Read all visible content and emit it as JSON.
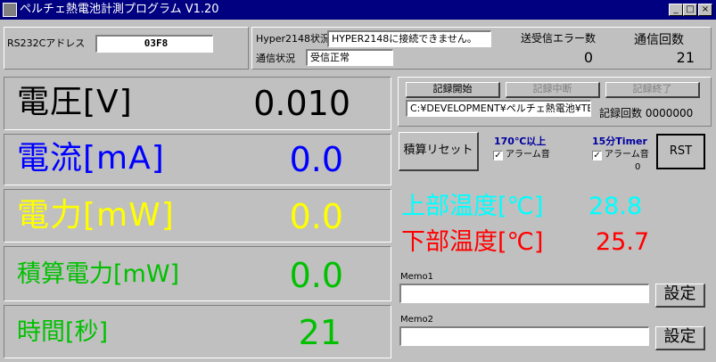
{
  "window": {
    "title": "ペルチェ熱電池計測プログラム  V1.20",
    "controls": {
      "minimize": "_",
      "maximize": "□",
      "close": "×"
    }
  },
  "comm": {
    "rs232c_label": "RS232Cアドレス",
    "rs232c_value": "03F8",
    "hyper_label": "Hyper2148状況",
    "hyper_value": "HYPER2148に接続できません。",
    "comm_label": "通信状況",
    "comm_value": "受信正常",
    "error_label": "送受信エラー数",
    "error_value": "0",
    "count_label": "通信回数",
    "count_value": "21"
  },
  "readings": {
    "voltage": {
      "label": "電圧[V]",
      "value": "0.010",
      "color": "#000000"
    },
    "current": {
      "label": "電流[mA]",
      "value": "0.0",
      "color": "#0000ff"
    },
    "power": {
      "label": "電力[mW]",
      "value": "0.0",
      "color": "#ffff00"
    },
    "cumulative": {
      "label": "積算電力[mW]",
      "value": "0.0",
      "color": "#00c000"
    },
    "time": {
      "label": "時間[秒]",
      "value": "21",
      "color": "#00c000"
    }
  },
  "recording": {
    "start_label": "記録開始",
    "pause_label": "記録中断",
    "end_label": "記録終了",
    "path_value": "C:¥DEVELOPMENT¥ペルチェ熱電池¥TE",
    "count_text": "記録回数 0000000"
  },
  "controls": {
    "reset_total_label": "積算リセット",
    "alarm170_title": "170℃以上",
    "alarm170_check": "アラーム音",
    "timer_title": "15分Timer",
    "timer_check": "アラーム音",
    "timer_value": "0",
    "rst_label": "RST"
  },
  "temps": {
    "upper_label": "上部温度[℃]",
    "upper_value": "28.8",
    "upper_color": "#00ffff",
    "lower_label": "下部温度[℃]",
    "lower_value": "25.7",
    "lower_color": "#ff0000"
  },
  "memos": {
    "memo1_label": "Memo1",
    "memo1_value": "",
    "memo2_label": "Memo2",
    "memo2_value": "",
    "set_label": "設定"
  }
}
